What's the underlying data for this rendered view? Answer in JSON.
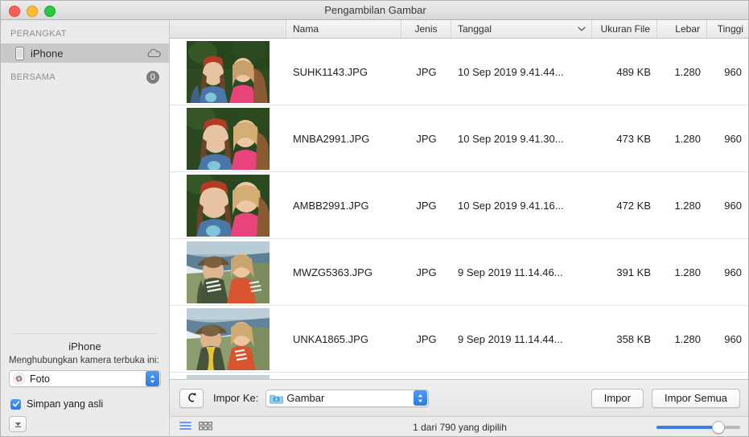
{
  "window": {
    "title": "Pengambilan Gambar",
    "traffic_lights": [
      "close-button",
      "minimize-button",
      "zoom-button"
    ]
  },
  "sidebar": {
    "sections": [
      {
        "title": "PERANGKAT",
        "items": [
          {
            "label": "iPhone",
            "icon": "iphone-icon",
            "trailing_icon": "cloud-icon",
            "selected": true
          }
        ]
      },
      {
        "title": "BERSAMA",
        "badge": "0",
        "items": []
      }
    ],
    "footer": {
      "device_name": "iPhone",
      "connect_label": "Menghubungkan kamera terbuka ini:",
      "app_popup": {
        "value": "Foto",
        "icon": "photos-app-icon"
      },
      "keep_originals": {
        "label": "Simpan yang asli",
        "checked": true
      },
      "eject_button": "eject-button"
    }
  },
  "table": {
    "columns": [
      {
        "key": "thumb",
        "label": ""
      },
      {
        "key": "name",
        "label": "Nama"
      },
      {
        "key": "jenis",
        "label": "Jenis"
      },
      {
        "key": "tgl",
        "label": "Tanggal",
        "sorted": true,
        "sort_caret": "chevron-down-icon"
      },
      {
        "key": "ukuran",
        "label": "Ukuran File"
      },
      {
        "key": "lebar",
        "label": "Lebar"
      },
      {
        "key": "tinggi",
        "label": "Tinggi"
      }
    ],
    "rows": [
      {
        "name": "SUHK1143.JPG",
        "jenis": "JPG",
        "tgl": "10 Sep 2019 9.41.44...",
        "ukuran": "489 KB",
        "lebar": "1.280",
        "tinggi": "960",
        "thumb": "two-women-forest-red-beanie"
      },
      {
        "name": "MNBA2991.JPG",
        "jenis": "JPG",
        "tgl": "10 Sep 2019 9.41.30...",
        "ukuran": "473 KB",
        "lebar": "1.280",
        "tinggi": "960",
        "thumb": "two-women-forest-laughing"
      },
      {
        "name": "AMBB2991.JPG",
        "jenis": "JPG",
        "tgl": "10 Sep 2019 9.41.16...",
        "ukuran": "472 KB",
        "lebar": "1.280",
        "tinggi": "960",
        "thumb": "two-women-forest-closeup"
      },
      {
        "name": "MWZG5363.JPG",
        "jenis": "JPG",
        "tgl": "9 Sep 2019 11.14.46...",
        "ukuran": "391 KB",
        "lebar": "1.280",
        "tinggi": "960",
        "thumb": "two-women-coast-hat"
      },
      {
        "name": "UNKA1865.JPG",
        "jenis": "JPG",
        "tgl": "9 Sep 2019 11.14.44...",
        "ukuran": "358 KB",
        "lebar": "1.280",
        "tinggi": "960",
        "thumb": "two-women-coast-yellow-scarf"
      }
    ]
  },
  "toolbar": {
    "rotate_button": "rotate-left-icon",
    "import_to_label": "Impor Ke:",
    "destination": {
      "value": "Gambar",
      "icon": "pictures-folder-icon"
    },
    "import_button": "Impor",
    "import_all_button": "Impor Semua"
  },
  "statusbar": {
    "list_view_icon": "list-view-icon",
    "grid_view_icon": "grid-view-icon",
    "status": "1 dari 790 yang dipilih",
    "zoom_slider": {
      "value": 74
    }
  },
  "colors": {
    "accent": "#3b7ee8",
    "selection": "#c9c9c9",
    "badge": "#7d7d7d"
  }
}
